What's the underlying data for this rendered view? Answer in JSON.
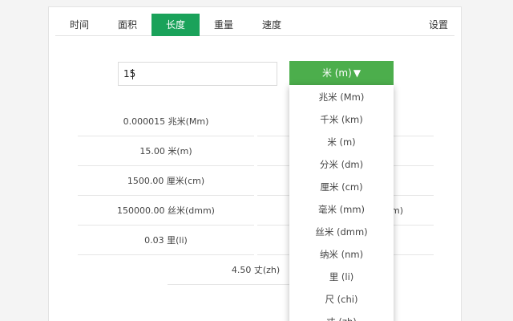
{
  "tabs": [
    {
      "label": "时间",
      "active": false
    },
    {
      "label": "面积",
      "active": false
    },
    {
      "label": "长度",
      "active": true
    },
    {
      "label": "重量",
      "active": false
    },
    {
      "label": "速度",
      "active": false
    }
  ],
  "settings_label": "设置",
  "input": {
    "value": "15"
  },
  "unit_select": {
    "label": "米 (m)",
    "arrow": "▼"
  },
  "results": {
    "left": [
      "0.000015 兆米(Mm)",
      "15.00 米(m)",
      "1500.00 厘米(cm)",
      "150000.00 丝米(dmm)",
      "0.03 里(li)"
    ],
    "right_partial": [
      "m)"
    ],
    "center": "4.50 丈(zh)"
  },
  "dropdown": {
    "items": [
      "兆米 (Mm)",
      "千米 (km)",
      "米 (m)",
      "分米 (dm)",
      "厘米 (cm)",
      "毫米 (mm)",
      "丝米 (dmm)",
      "纳米 (nm)",
      "里 (li)",
      "尺 (chi)",
      "丈 (zh)"
    ]
  },
  "colors": {
    "active_tab": "#1aa25a",
    "select_button": "#4cae4c"
  }
}
